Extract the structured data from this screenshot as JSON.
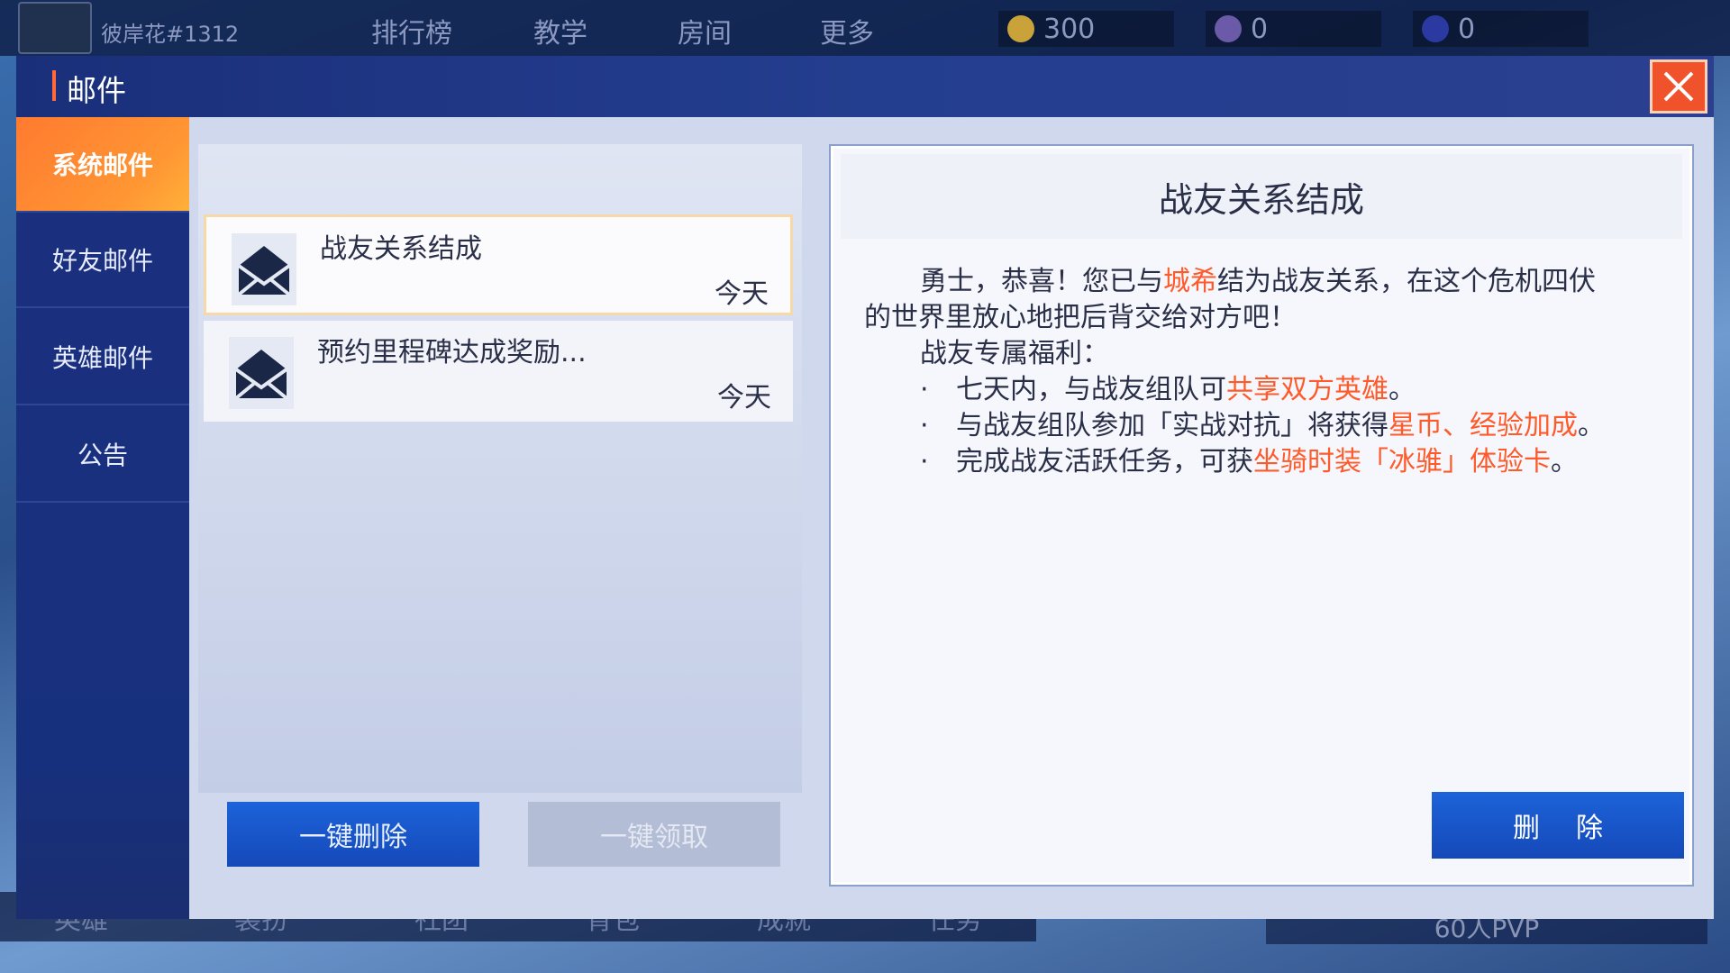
{
  "topbar": {
    "player_name": "彼岸花#1312",
    "nav": [
      "排行榜",
      "教学",
      "房间",
      "更多"
    ],
    "coins": "300",
    "gems": "0",
    "tickets": "0"
  },
  "bottombar": {
    "items": [
      "英雄",
      "装扮",
      "社团",
      "背包",
      "成就",
      "任务"
    ],
    "pvp": "60人PVP"
  },
  "dialog": {
    "title": "邮件",
    "close_icon": "close-icon"
  },
  "sidebar": {
    "items": [
      {
        "label": "系统邮件",
        "active": true
      },
      {
        "label": "好友邮件",
        "active": false
      },
      {
        "label": "英雄邮件",
        "active": false
      },
      {
        "label": "公告",
        "active": false
      }
    ]
  },
  "mail_list": [
    {
      "subject": "战友关系结成",
      "date": "今天",
      "selected": true
    },
    {
      "subject": "预约里程碑达成奖励...",
      "date": "今天",
      "selected": false
    }
  ],
  "buttons": {
    "delete_all": "一键删除",
    "claim_all": "一键领取",
    "delete": "删除"
  },
  "detail": {
    "title": "战友关系结成",
    "p1_a": "勇士，恭喜！您已与",
    "p1_hl": "城希",
    "p1_b": "结为战友关系，在这个危机四伏",
    "p1_c": "的世界里放心地把后背交给对方吧！",
    "benefits_title": "战友专属福利：",
    "b1_a": "七天内，与战友组队可",
    "b1_hl": "共享双方英雄",
    "b1_b": "。",
    "b2_a": "与战友组队参加「实战对抗」将获得",
    "b2_hl": "星币、经验加成",
    "b2_b": "。",
    "b3_a": "完成战友活跃任务，可获",
    "b3_hl": "坐骑时装「冰骓」体验卡",
    "b3_b": "。"
  },
  "colors": {
    "accent_orange": "#ff8a33",
    "highlight_red": "#ff5a2a",
    "button_blue": "#1a58cc"
  }
}
